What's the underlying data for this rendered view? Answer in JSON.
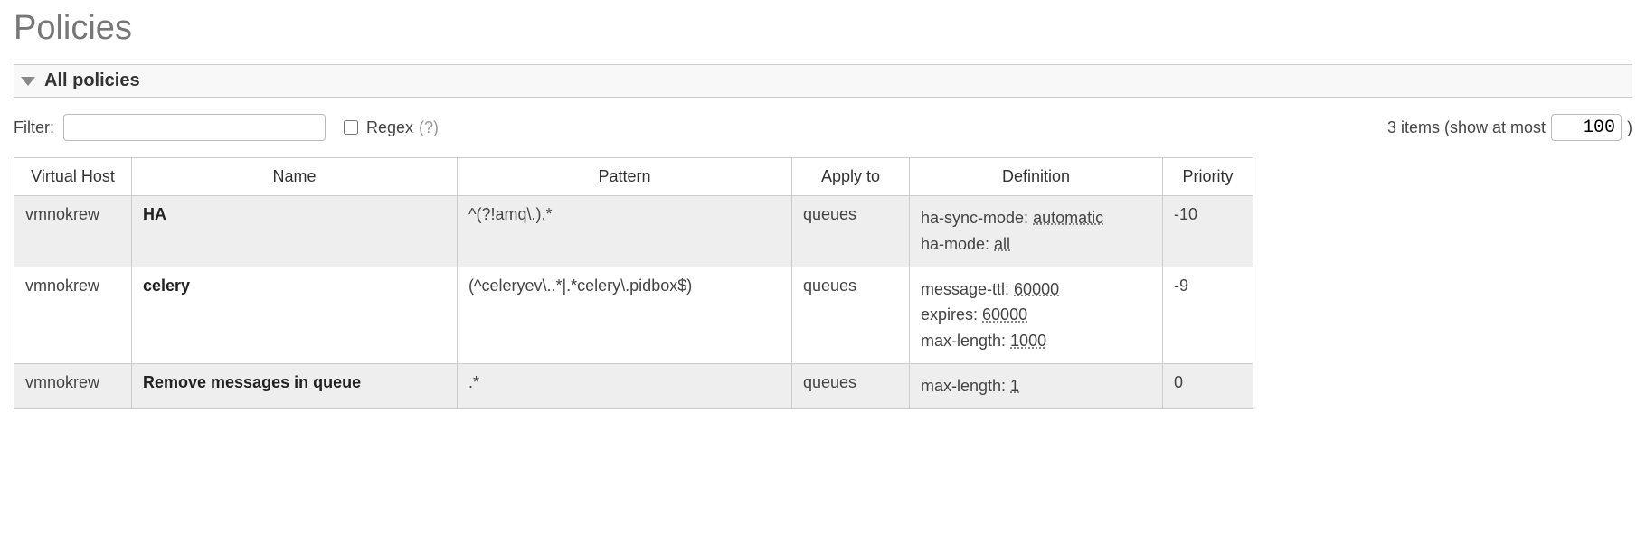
{
  "page": {
    "title": "Policies"
  },
  "section": {
    "title": "All policies"
  },
  "filter": {
    "label": "Filter:",
    "value": "",
    "regex_label": "Regex",
    "regex_help": "(?)",
    "regex_checked": false
  },
  "summary": {
    "count_text": "3 items (show at most",
    "max_value": "100",
    "trailing": ")"
  },
  "columns": {
    "vhost": "Virtual Host",
    "name": "Name",
    "pattern": "Pattern",
    "apply_to": "Apply to",
    "definition": "Definition",
    "priority": "Priority"
  },
  "rows": [
    {
      "vhost": "vmnokrew",
      "name": "HA",
      "pattern": "^(?!amq\\.).*",
      "apply_to": "queues",
      "definition": [
        {
          "key": "ha-sync-mode",
          "val": "automatic"
        },
        {
          "key": "ha-mode",
          "val": "all"
        }
      ],
      "priority": "-10"
    },
    {
      "vhost": "vmnokrew",
      "name": "celery",
      "pattern": "(^celeryev\\..*|.*celery\\.pidbox$)",
      "apply_to": "queues",
      "definition": [
        {
          "key": "message-ttl",
          "val": "60000"
        },
        {
          "key": "expires",
          "val": "60000"
        },
        {
          "key": "max-length",
          "val": "1000"
        }
      ],
      "priority": "-9"
    },
    {
      "vhost": "vmnokrew",
      "name": "Remove messages in queue",
      "pattern": ".*",
      "apply_to": "queues",
      "definition": [
        {
          "key": "max-length",
          "val": "1"
        }
      ],
      "priority": "0"
    }
  ]
}
